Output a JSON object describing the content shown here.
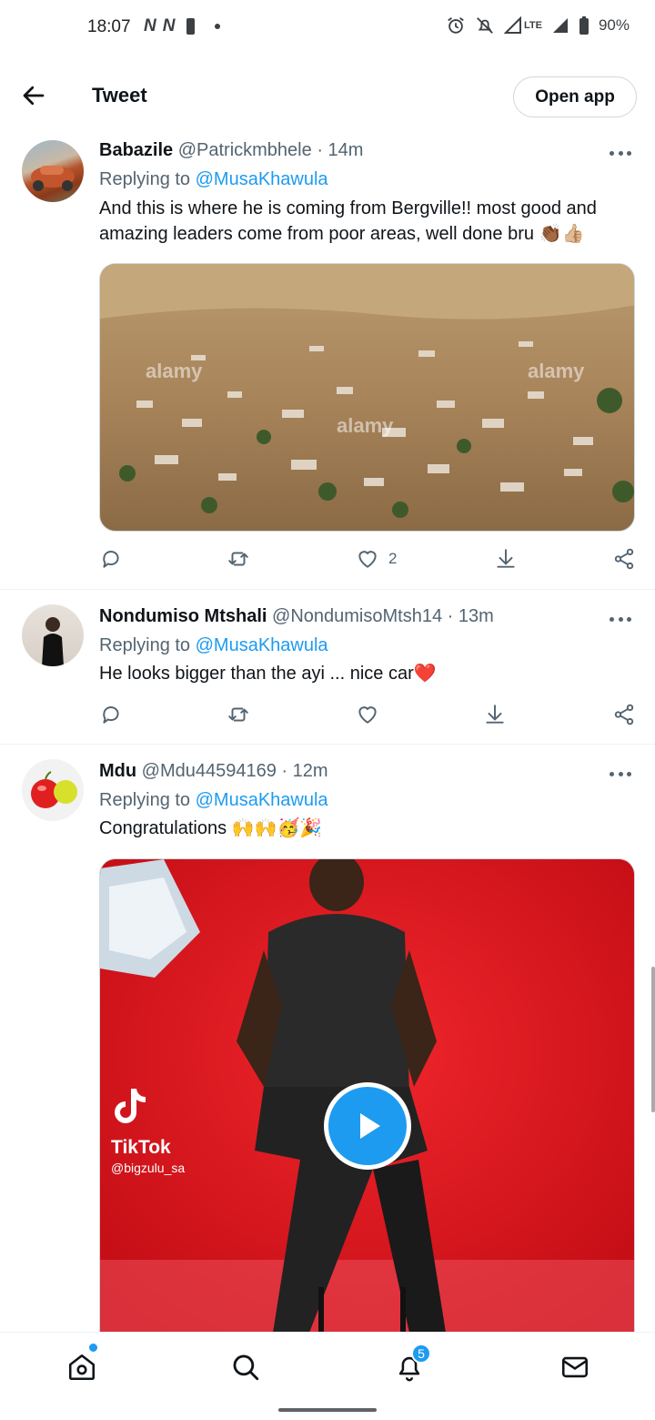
{
  "status_bar": {
    "time": "18:07",
    "left_icons": [
      "N",
      "N"
    ],
    "right_icons": [
      "alarm-icon",
      "mute-icon",
      "signal-icon",
      "lte-icon",
      "signal-icon",
      "battery-icon"
    ],
    "lte": "LTE",
    "battery": "90%"
  },
  "header": {
    "title": "Tweet",
    "open_app": "Open app"
  },
  "tweets": [
    {
      "name": "Babazile",
      "handle": "@Patrickmbhele",
      "time": "· 14m",
      "replying_prefix": "Replying to",
      "replying_handle": "@MusaKhawula",
      "text": "And this is where he is coming from Bergville!! most good and amazing leaders come from poor areas, well done bru 👏🏾👍🏼",
      "media_watermark": "alamy",
      "likes": "2"
    },
    {
      "name": "Nondumiso Mtshali",
      "handle": "@NondumisoMtsh14",
      "time": "· 13m",
      "replying_prefix": "Replying to",
      "replying_handle": "@MusaKhawula",
      "text": "He looks bigger than the ayi ... nice car❤️",
      "likes": ""
    },
    {
      "name": "Mdu",
      "handle": "@Mdu44594169",
      "time": "· 12m",
      "replying_prefix": "Replying to",
      "replying_handle": "@MusaKhawula",
      "text": "Congratulations 🙌🙌🥳🎉",
      "video": {
        "brand": "TikTok",
        "handle": "@bigzulu_sa"
      }
    }
  ],
  "bottom_nav": {
    "items": [
      "home-icon",
      "search-icon",
      "notifications-icon",
      "messages-icon"
    ],
    "notification_count": "5"
  },
  "colors": {
    "accent": "#1d9bf0",
    "text": "#0f1419",
    "secondary": "#536471",
    "video_bg": "#e0141c"
  }
}
